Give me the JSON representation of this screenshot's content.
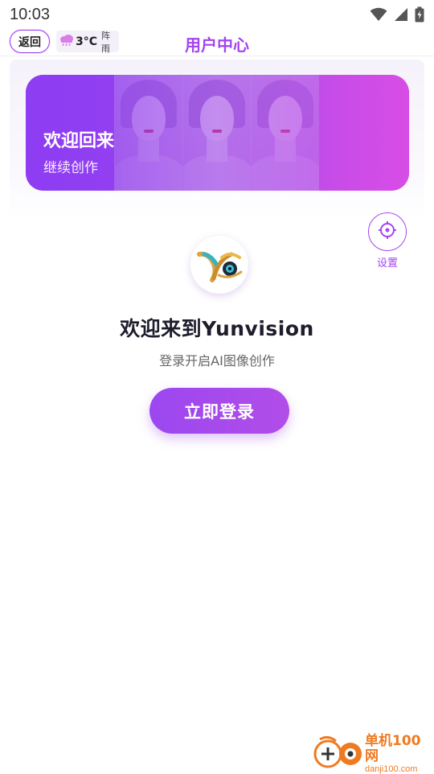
{
  "status_bar": {
    "time": "10:03",
    "icons": [
      "wifi-icon",
      "cell-signal-icon",
      "battery-charging-icon"
    ]
  },
  "header": {
    "back_label": "返回",
    "weather": {
      "icon": "rain-cloud-icon",
      "temperature": "3°C",
      "condition": "阵雨"
    },
    "title": "用户中心"
  },
  "banner": {
    "title": "欢迎回来",
    "subtitle": "继续创作"
  },
  "settings": {
    "icon": "gear-icon",
    "label": "设置"
  },
  "main": {
    "heading": "欢迎来到Yunvision",
    "subheading": "登录开启AI图像创作",
    "login_label": "立即登录"
  },
  "watermark": {
    "name": "单机100网",
    "url": "danji100.com"
  },
  "colors": {
    "accent": "#a343f0",
    "banner_start": "#8e3df2",
    "banner_end": "#d94de6",
    "watermark": "#ef7a22"
  }
}
